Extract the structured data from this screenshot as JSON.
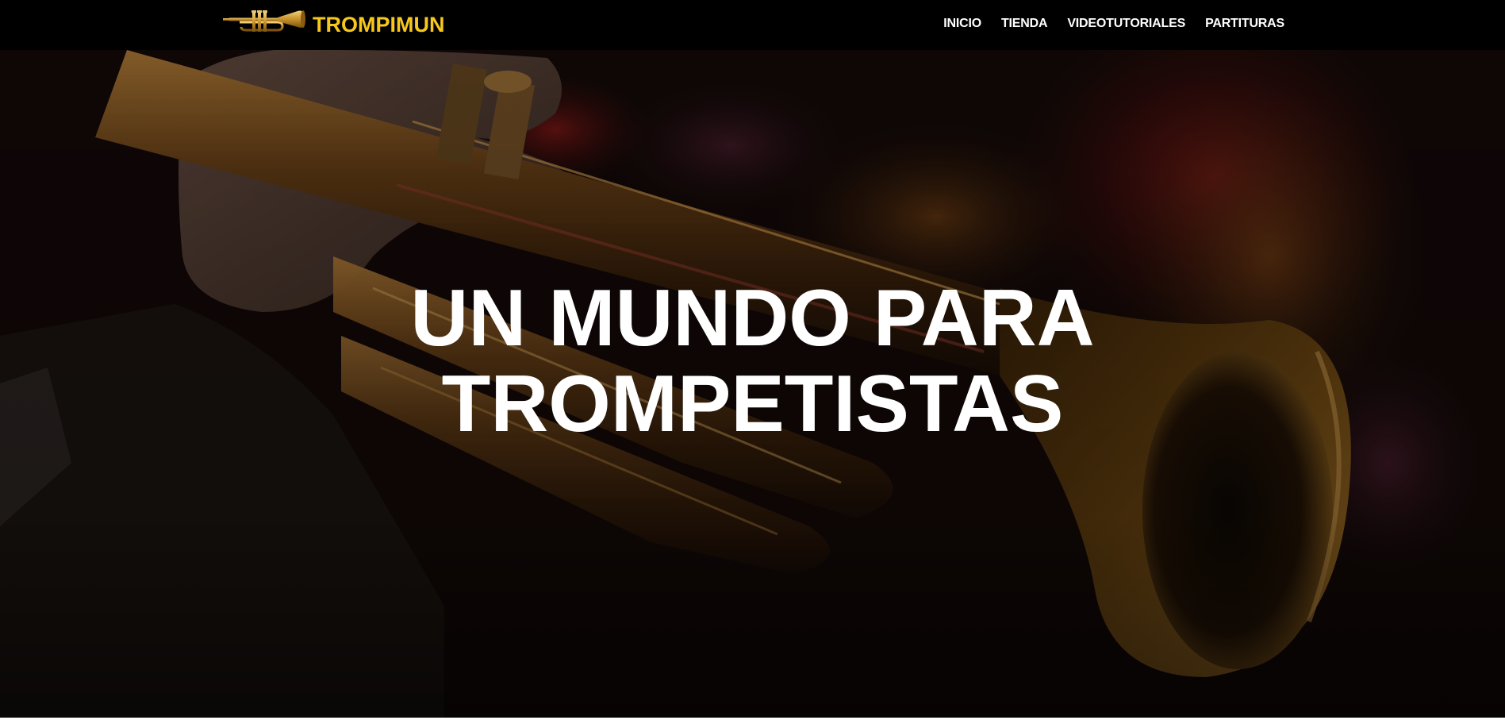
{
  "header": {
    "logo_icon": "trumpet-logo-icon",
    "brand_name": "TROMPIMUN",
    "nav": [
      {
        "label": "INICIO"
      },
      {
        "label": "TIENDA"
      },
      {
        "label": "VIDEOTUTORIALES"
      },
      {
        "label": "PARTITURAS"
      }
    ]
  },
  "hero": {
    "title_line1": "UN MUNDO PARA",
    "title_line2": "TROMPETISTAS",
    "background": "trumpet-player-photo"
  },
  "colors": {
    "header_bg": "#000000",
    "brand": "#f7c81c",
    "nav_text": "#ffffff",
    "hero_text": "#ffffff"
  }
}
